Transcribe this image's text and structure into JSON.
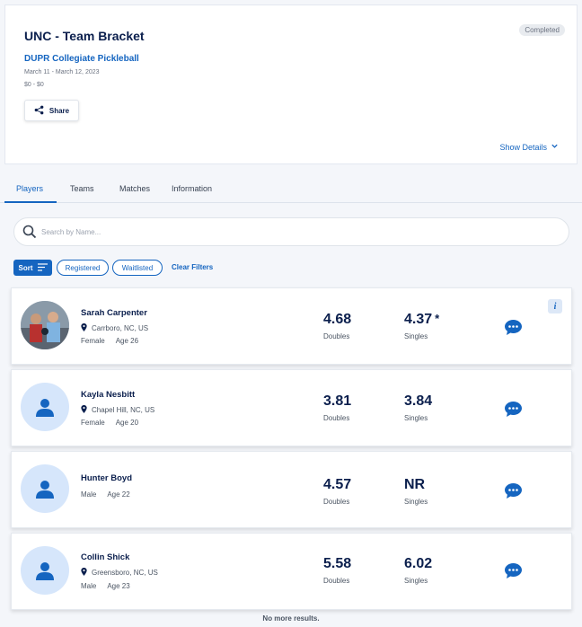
{
  "event": {
    "title": "UNC - Team Bracket",
    "status": "Completed",
    "organizer": "DUPR Collegiate Pickleball",
    "dates": "March 11 - March 12, 2023",
    "price": "$0 - $0",
    "share_label": "Share",
    "show_details_label": "Show Details"
  },
  "tabs": [
    {
      "label": "Players",
      "active": true
    },
    {
      "label": "Teams",
      "active": false
    },
    {
      "label": "Matches",
      "active": false
    },
    {
      "label": "Information",
      "active": false
    }
  ],
  "search": {
    "placeholder": "Search by Name..."
  },
  "filters": {
    "sort_label": "Sort",
    "chips": [
      "Registered",
      "Waitlisted"
    ],
    "clear_label": "Clear Filters"
  },
  "players": [
    {
      "name": "Sarah Carpenter",
      "location": "Carrboro, NC, US",
      "gender": "Female",
      "age": "Age 26",
      "doubles": "4.68",
      "doubles_label": "Doubles",
      "singles": "4.37",
      "singles_label": "Singles",
      "singles_asterisk": "*",
      "has_photo": true
    },
    {
      "name": "Kayla Nesbitt",
      "location": "Chapel Hill, NC, US",
      "gender": "Female",
      "age": "Age 20",
      "doubles": "3.81",
      "doubles_label": "Doubles",
      "singles": "3.84",
      "singles_label": "Singles",
      "has_photo": false
    },
    {
      "name": "Hunter Boyd",
      "location": "",
      "gender": "Male",
      "age": "Age 22",
      "doubles": "4.57",
      "doubles_label": "Doubles",
      "singles": "NR",
      "singles_label": "Singles",
      "has_photo": false
    },
    {
      "name": "Collin Shick",
      "location": "Greensboro, NC, US",
      "gender": "Male",
      "age": "Age 23",
      "doubles": "5.58",
      "doubles_label": "Doubles",
      "singles": "6.02",
      "singles_label": "Singles",
      "has_photo": false
    }
  ],
  "footer": {
    "no_more_results": "No more results."
  },
  "colors": {
    "accent": "#1565c0",
    "text": "#0b1f4d",
    "avatar_bg": "#d6e6fb"
  }
}
